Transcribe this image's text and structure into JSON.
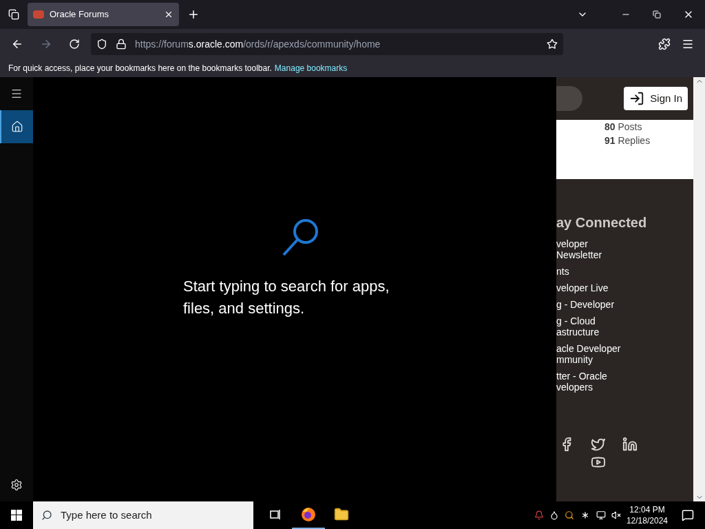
{
  "browser": {
    "tabs": [
      {
        "title": "Oracle Forums",
        "selected": true
      }
    ],
    "url": {
      "host_prefix": "https://forum",
      "host": "s.oracle.com",
      "path": "/ords/r/apexds/community/home"
    },
    "bookmarks_bar": {
      "hint": "For quick access, place your bookmarks here on the bookmarks toolbar.",
      "link": "Manage bookmarks"
    }
  },
  "start_menu": {
    "rail": [
      {
        "kind": "menu",
        "selected": false
      },
      {
        "kind": "home",
        "selected": true
      },
      {
        "kind": "settings",
        "selected": false
      }
    ],
    "message": "Start typing to search for apps, files, and settings."
  },
  "page": {
    "sign_in": "Sign In",
    "stats": [
      {
        "count": "80",
        "label": "Posts"
      },
      {
        "count": "91",
        "label": "Replies"
      }
    ],
    "heading": "ay Connected",
    "links": [
      "veloper Newsletter",
      "nts",
      "veloper Live",
      "g - Developer",
      "g - Cloud astructure",
      "acle Developer mmunity",
      "tter - Oracle velopers"
    ]
  },
  "taskbar": {
    "search_placeholder": "Type here to search",
    "apps": [
      {
        "kind": "taskview",
        "selected": false
      },
      {
        "kind": "firefox",
        "selected": true
      },
      {
        "kind": "files",
        "selected": false
      }
    ],
    "time": "12:04 PM",
    "date": "12/18/2024"
  }
}
